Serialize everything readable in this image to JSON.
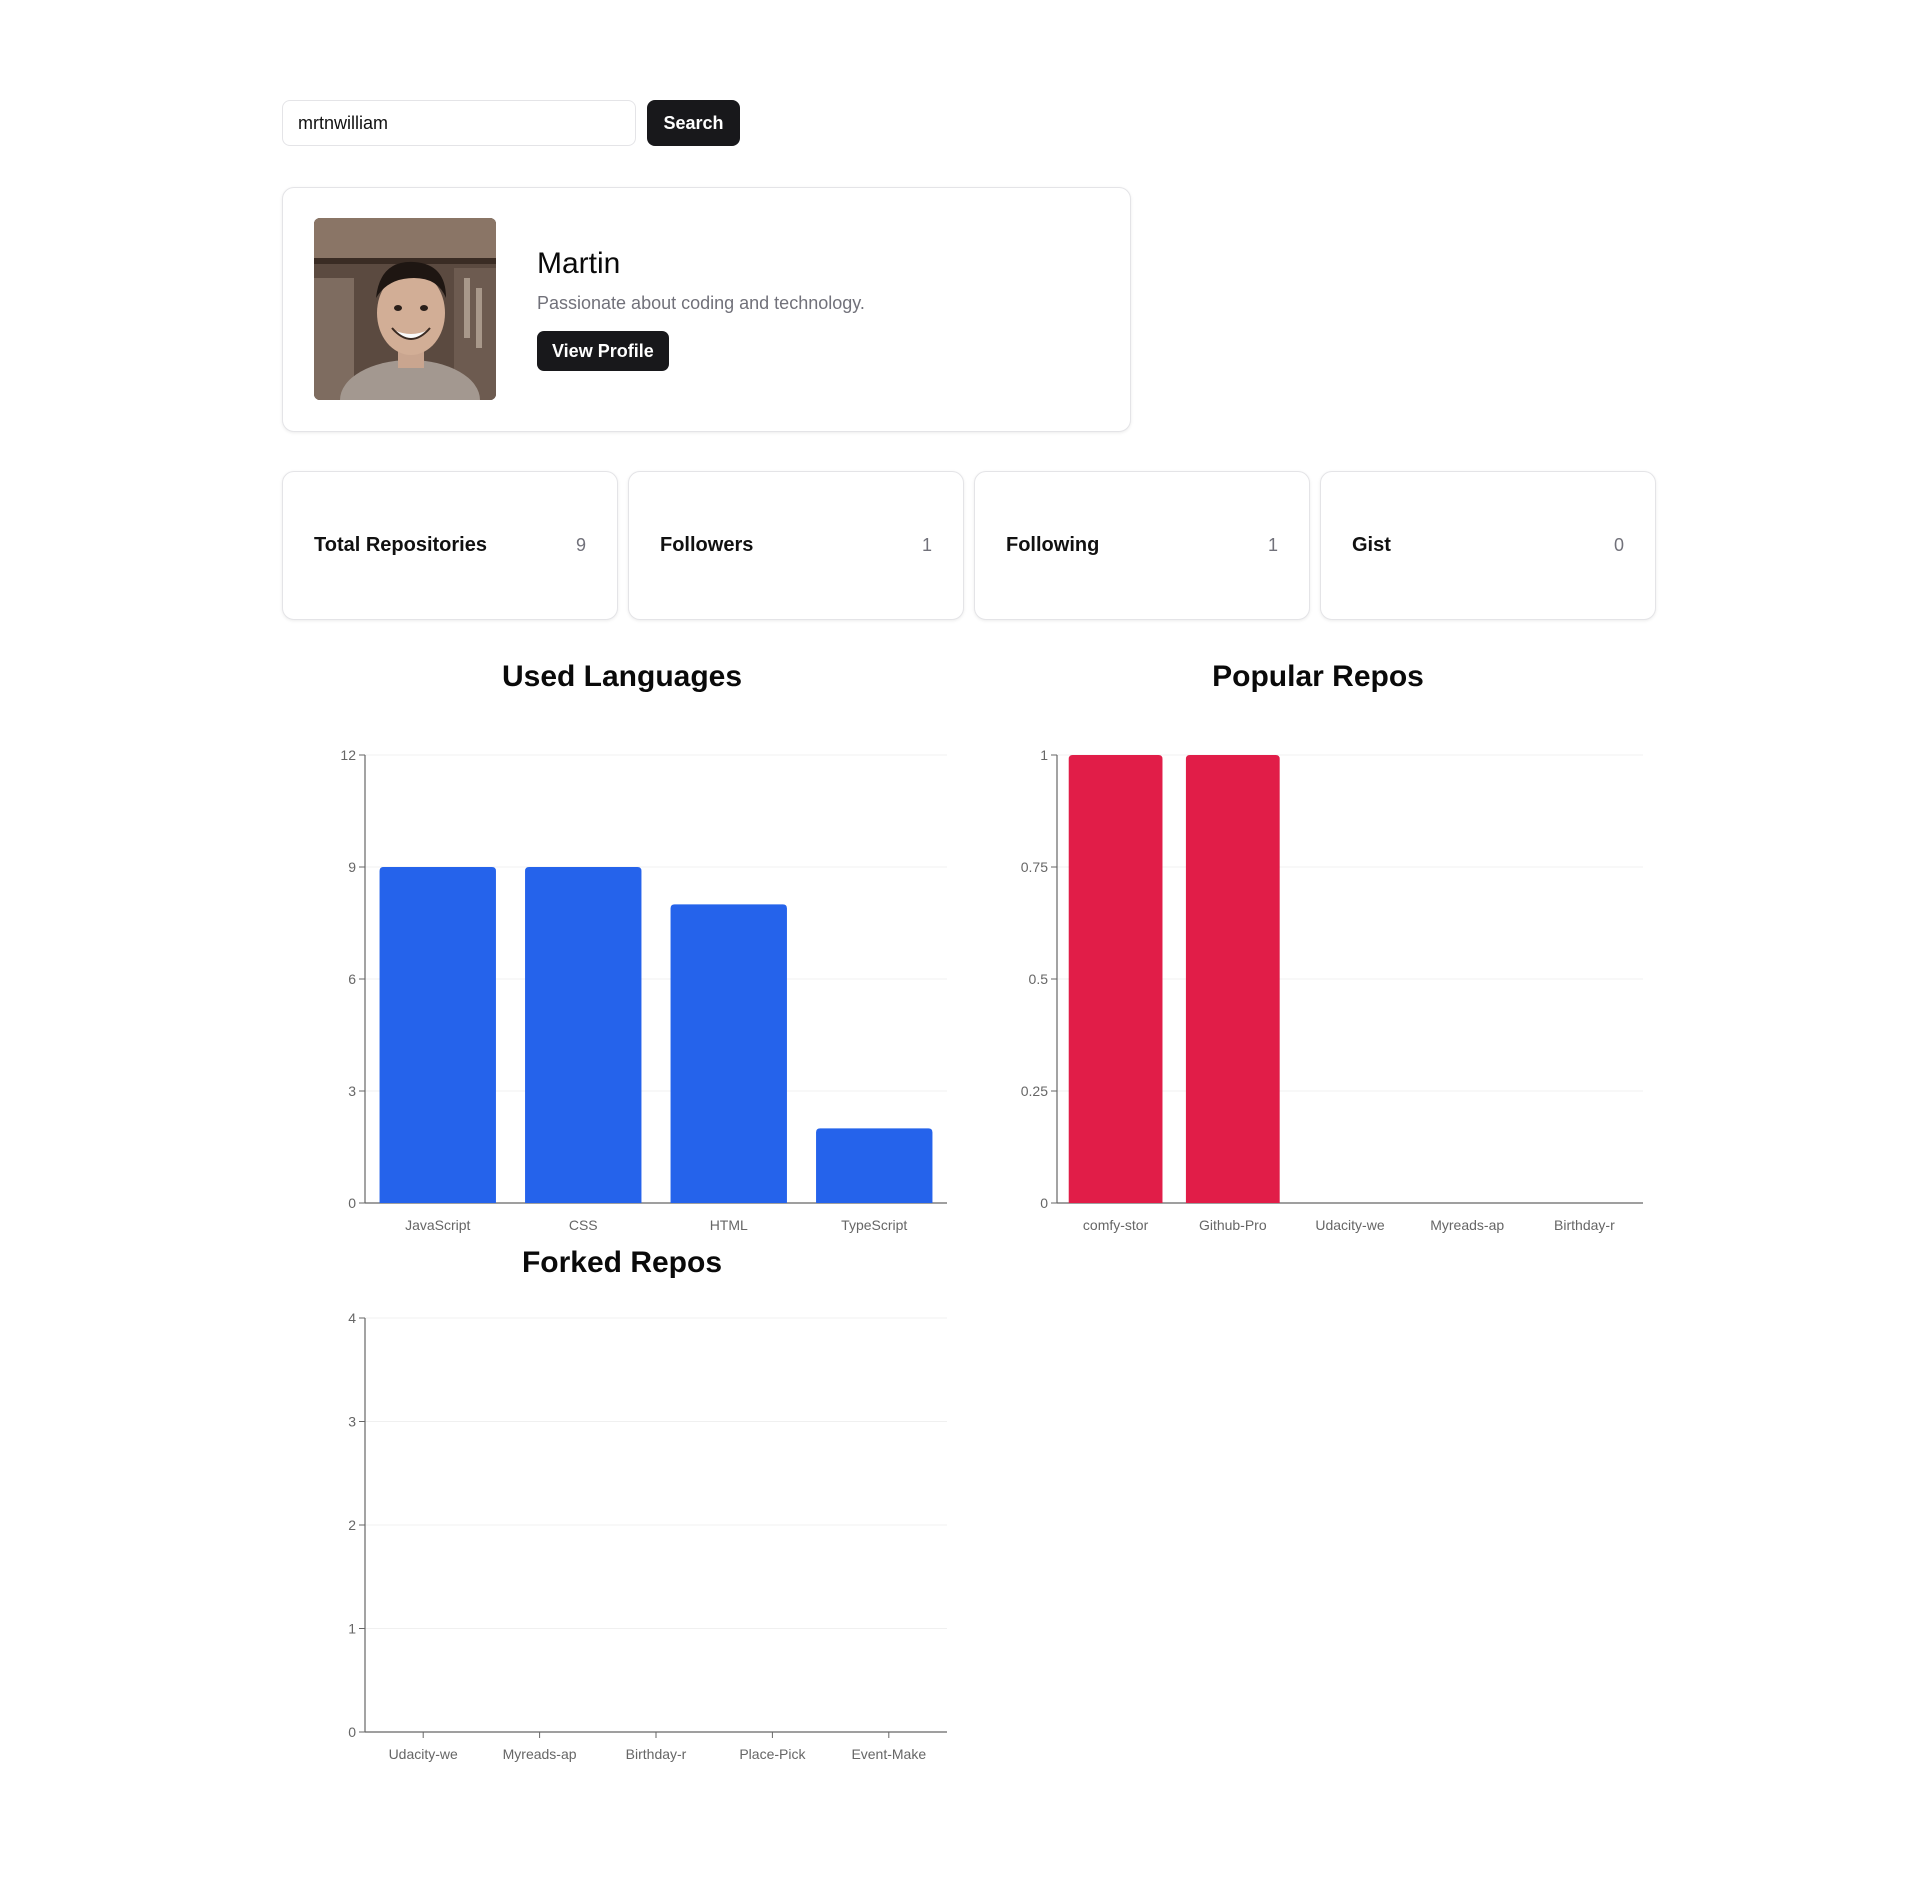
{
  "search": {
    "value": "mrtnwilliam",
    "button_label": "Search"
  },
  "profile": {
    "name": "Martin",
    "bio": "Passionate about coding and technology.",
    "button_label": "View Profile"
  },
  "stats": [
    {
      "label": "Total Repositories",
      "value": "9"
    },
    {
      "label": "Followers",
      "value": "1"
    },
    {
      "label": "Following",
      "value": "1"
    },
    {
      "label": "Gist",
      "value": "0"
    }
  ],
  "colors": {
    "languages_bar": "#2563eb",
    "popular_bar": "#e11d48",
    "dark_button": "#18181b"
  },
  "chart_data": [
    {
      "type": "bar",
      "title": "Used Languages",
      "categories": [
        "JavaScript",
        "CSS",
        "HTML",
        "TypeScript"
      ],
      "values": [
        9,
        9,
        8,
        2
      ],
      "ylim": [
        0,
        12
      ],
      "yticks": [
        0,
        3,
        6,
        9,
        12
      ],
      "color": "#2563eb",
      "grid": true
    },
    {
      "type": "bar",
      "title": "Popular Repos",
      "categories": [
        "comfy-stor",
        "Github-Pro",
        "Udacity-we",
        "Myreads-ap",
        "Birthday-r"
      ],
      "values": [
        1,
        1,
        0,
        0,
        0
      ],
      "ylim": [
        0,
        1
      ],
      "yticks": [
        0,
        0.25,
        0.5,
        0.75,
        1
      ],
      "color": "#e11d48",
      "grid": true
    },
    {
      "type": "bar",
      "title": "Forked Repos",
      "categories": [
        "Udacity-we",
        "Myreads-ap",
        "Birthday-r",
        "Place-Pick",
        "Event-Make"
      ],
      "values": [
        0,
        0,
        0,
        0,
        0
      ],
      "ylim": [
        0,
        4
      ],
      "yticks": [
        0,
        1,
        2,
        3,
        4
      ],
      "color": "#2563eb",
      "grid": true
    }
  ]
}
